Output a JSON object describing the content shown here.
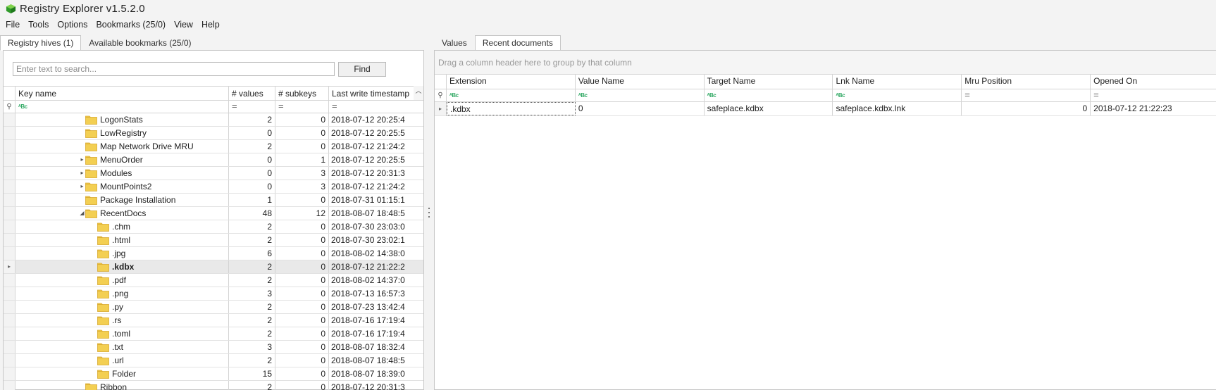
{
  "app": {
    "title": "Registry Explorer v1.5.2.0"
  },
  "menu": [
    "File",
    "Tools",
    "Options",
    "Bookmarks (25/0)",
    "View",
    "Help"
  ],
  "left_tabs": [
    "Registry hives (1)",
    "Available bookmarks (25/0)"
  ],
  "search": {
    "placeholder": "Enter text to search...",
    "find_label": "Find"
  },
  "tree": {
    "columns": [
      "Key name",
      "# values",
      "# subkeys",
      "Last write timestamp"
    ],
    "filter": {
      "key": "ᴬBc",
      "eq": "="
    },
    "rows": [
      {
        "name": "LogonStats",
        "values": "2",
        "subkeys": "0",
        "ts": "2018-07-12 20:25:4",
        "expander": "",
        "level": 1,
        "selected": false
      },
      {
        "name": "LowRegistry",
        "values": "0",
        "subkeys": "0",
        "ts": "2018-07-12 20:25:5",
        "expander": "",
        "level": 1,
        "selected": false
      },
      {
        "name": "Map Network Drive MRU",
        "values": "2",
        "subkeys": "0",
        "ts": "2018-07-12 21:24:2",
        "expander": "",
        "level": 1,
        "selected": false
      },
      {
        "name": "MenuOrder",
        "values": "0",
        "subkeys": "1",
        "ts": "2018-07-12 20:25:5",
        "expander": "▸",
        "level": 1,
        "selected": false
      },
      {
        "name": "Modules",
        "values": "0",
        "subkeys": "3",
        "ts": "2018-07-12 20:31:3",
        "expander": "▸",
        "level": 1,
        "selected": false
      },
      {
        "name": "MountPoints2",
        "values": "0",
        "subkeys": "3",
        "ts": "2018-07-12 21:24:2",
        "expander": "▸",
        "level": 1,
        "selected": false
      },
      {
        "name": "Package Installation",
        "values": "1",
        "subkeys": "0",
        "ts": "2018-07-31 01:15:1",
        "expander": "",
        "level": 1,
        "selected": false
      },
      {
        "name": "RecentDocs",
        "values": "48",
        "subkeys": "12",
        "ts": "2018-08-07 18:48:5",
        "expander": "◢",
        "level": 1,
        "selected": false
      },
      {
        "name": ".chm",
        "values": "2",
        "subkeys": "0",
        "ts": "2018-07-30 23:03:0",
        "expander": "",
        "level": 2,
        "selected": false
      },
      {
        "name": ".html",
        "values": "2",
        "subkeys": "0",
        "ts": "2018-07-30 23:02:1",
        "expander": "",
        "level": 2,
        "selected": false
      },
      {
        "name": ".jpg",
        "values": "6",
        "subkeys": "0",
        "ts": "2018-08-02 14:38:0",
        "expander": "",
        "level": 2,
        "selected": false
      },
      {
        "name": ".kdbx",
        "values": "2",
        "subkeys": "0",
        "ts": "2018-07-12 21:22:2",
        "expander": "",
        "level": 2,
        "selected": true
      },
      {
        "name": ".pdf",
        "values": "2",
        "subkeys": "0",
        "ts": "2018-08-02 14:37:0",
        "expander": "",
        "level": 2,
        "selected": false
      },
      {
        "name": ".png",
        "values": "3",
        "subkeys": "0",
        "ts": "2018-07-13 16:57:3",
        "expander": "",
        "level": 2,
        "selected": false
      },
      {
        "name": ".py",
        "values": "2",
        "subkeys": "0",
        "ts": "2018-07-23 13:42:4",
        "expander": "",
        "level": 2,
        "selected": false
      },
      {
        "name": ".rs",
        "values": "2",
        "subkeys": "0",
        "ts": "2018-07-16 17:19:4",
        "expander": "",
        "level": 2,
        "selected": false
      },
      {
        "name": ".toml",
        "values": "2",
        "subkeys": "0",
        "ts": "2018-07-16 17:19:4",
        "expander": "",
        "level": 2,
        "selected": false
      },
      {
        "name": ".txt",
        "values": "3",
        "subkeys": "0",
        "ts": "2018-08-07 18:32:4",
        "expander": "",
        "level": 2,
        "selected": false
      },
      {
        "name": ".url",
        "values": "2",
        "subkeys": "0",
        "ts": "2018-08-07 18:48:5",
        "expander": "",
        "level": 2,
        "selected": false
      },
      {
        "name": "Folder",
        "values": "15",
        "subkeys": "0",
        "ts": "2018-08-07 18:39:0",
        "expander": "",
        "level": 2,
        "selected": false
      },
      {
        "name": "Ribbon",
        "values": "2",
        "subkeys": "0",
        "ts": "2018-07-12 20:31:3",
        "expander": "",
        "level": 1,
        "selected": false
      }
    ]
  },
  "right_tabs": [
    "Values",
    "Recent documents"
  ],
  "docs": {
    "group_hint": "Drag a column header here to group by that column",
    "columns": [
      "Extension",
      "Value Name",
      "Target Name",
      "Lnk Name",
      "Mru Position",
      "Opened On"
    ],
    "filter": {
      "abc": "ᴬBc",
      "eq": "="
    },
    "rows": [
      {
        "extension": ".kdbx",
        "value_name": "0",
        "target_name": "safeplace.kdbx",
        "lnk_name": "safeplace.kdbx.lnk",
        "mru_position": "0",
        "opened_on": "2018-07-12 21:22:23"
      }
    ]
  },
  "colors": {
    "folder": "#f3cf52",
    "folder_edge": "#d9a92e",
    "icon_green": "#3aa63a"
  }
}
